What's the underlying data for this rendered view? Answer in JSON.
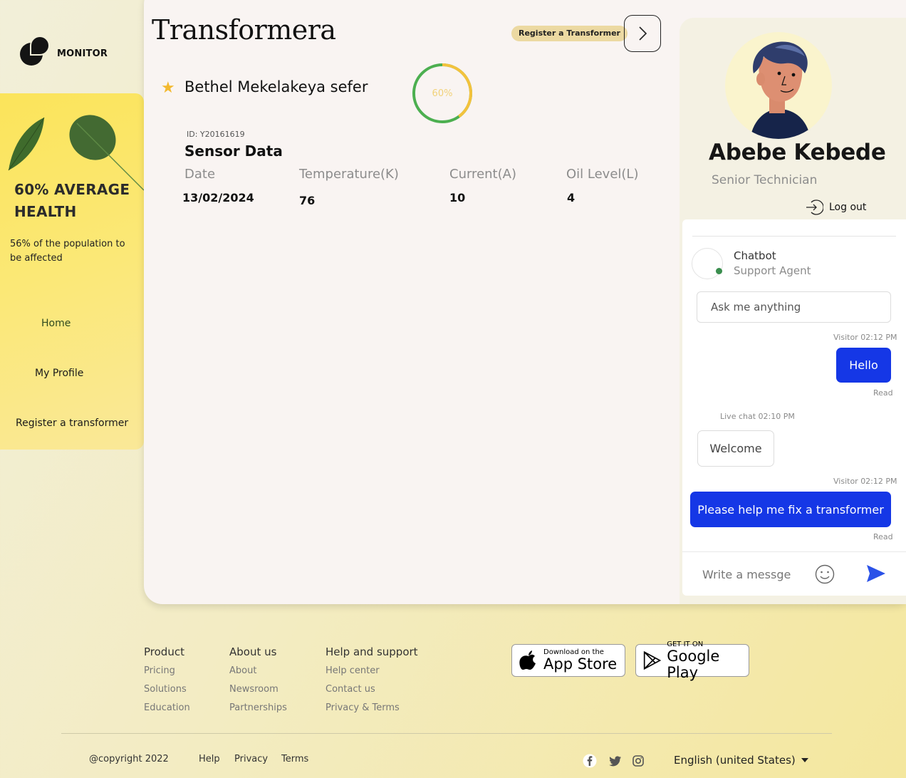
{
  "brand": {
    "name": "MONITOR"
  },
  "sidebar": {
    "health_title": "60% AVERAGE HEALTH",
    "health_subtitle": "56% of the population to be affected",
    "nav": {
      "home": "Home",
      "profile": "My Profile",
      "register": "Register a transformer"
    }
  },
  "header": {
    "title": "Transformera",
    "register_button": "Register a Transformer",
    "next_icon": "chevron-right-icon"
  },
  "transformer": {
    "name": "Bethel Mekelakeya sefer",
    "favorite_icon": "star-icon",
    "health_percent": 60,
    "health_label": "60%",
    "id_label": "ID: Y20161619",
    "section_title": "Sensor Data",
    "columns": [
      "Date",
      "Temperature(K)",
      "Current(A)",
      "Oil Level(L)"
    ],
    "rows": [
      [
        "13/02/2024",
        "76",
        "10",
        "4"
      ]
    ]
  },
  "profile": {
    "name": "Abebe Kebede",
    "role": "Senior Technician",
    "logout": "Log out"
  },
  "chat": {
    "agent_name": "Chatbot",
    "agent_role": "Support Agent",
    "ask_placeholder": "Ask me anything",
    "messages": [
      {
        "meta": "Visitor 02:12 PM",
        "text": "Hello",
        "status": "Read"
      },
      {
        "meta": "Live chat 02:10 PM",
        "text": "Welcome"
      },
      {
        "meta": "Visitor 02:12 PM",
        "text": "Please help me fix a transformer",
        "status": "Read"
      }
    ],
    "compose_placeholder": "Write a messge"
  },
  "footer": {
    "columns": [
      {
        "heading": "Product",
        "links": [
          "Pricing",
          "Solutions",
          "Education"
        ]
      },
      {
        "heading": "About us",
        "links": [
          "About",
          "Newsroom",
          "Partnerships"
        ]
      },
      {
        "heading": "Help and support",
        "links": [
          "Help center",
          "Contact us",
          "Privacy & Terms"
        ]
      }
    ],
    "app_store": {
      "small": "Download on the",
      "big": "App Store"
    },
    "google_play": {
      "small": "GET IT ON",
      "big": "Google Play"
    },
    "copyright": "@copyright 2022",
    "bottom_links": [
      "Help",
      "Privacy",
      "Terms"
    ],
    "language": "English (united States)"
  },
  "colors": {
    "accent_blue": "#1537e6",
    "progress_green": "#4caf50",
    "progress_yellow": "#f3c23c",
    "sidebar_yellow": "#fbe45a"
  }
}
